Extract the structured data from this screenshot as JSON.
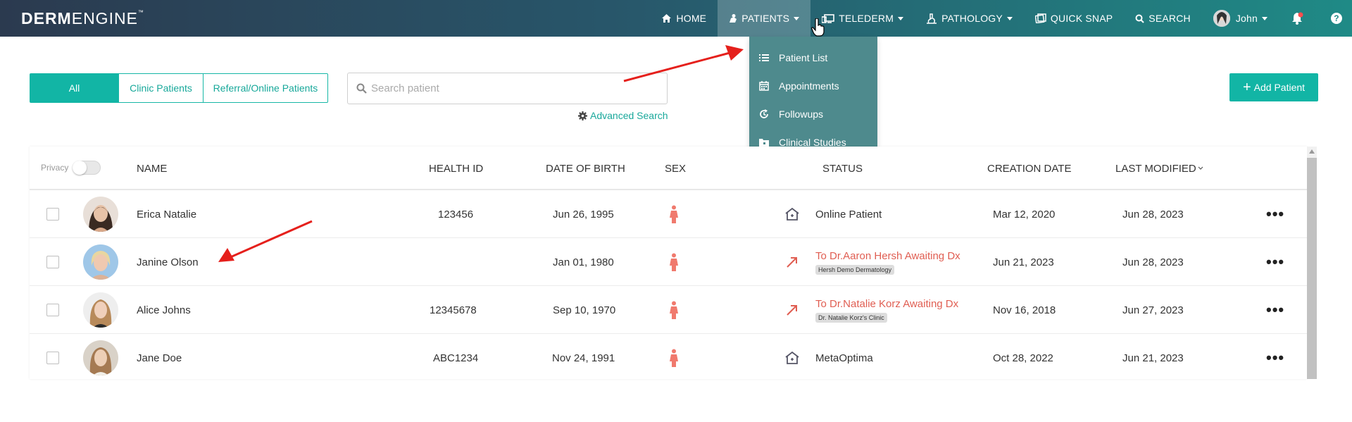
{
  "brand": {
    "bold": "DERM",
    "light": "ENGINE",
    "tm": "™"
  },
  "nav": {
    "home": "HOME",
    "patients": "PATIENTS",
    "telederm": "TELEDERM",
    "pathology": "PATHOLOGY",
    "quick_snap": "QUICK SNAP",
    "search": "SEARCH",
    "user": "John",
    "help": "?"
  },
  "patients_menu": {
    "items": [
      {
        "label": "Patient List",
        "icon": "list-icon"
      },
      {
        "label": "Appointments",
        "icon": "calendar-icon"
      },
      {
        "label": "Followups",
        "icon": "followup-icon"
      },
      {
        "label": "Clinical Studies",
        "icon": "folder-icon"
      }
    ]
  },
  "filters": {
    "all": "All",
    "clinic": "Clinic Patients",
    "referral": "Referral/Online Patients"
  },
  "search": {
    "placeholder": "Search patient",
    "advanced": "Advanced Search"
  },
  "add_patient": "Add Patient",
  "table": {
    "privacy": "Privacy",
    "headers": {
      "name": "NAME",
      "health_id": "HEALTH ID",
      "dob": "DATE OF BIRTH",
      "sex": "SEX",
      "status": "STATUS",
      "creation_date": "CREATION DATE",
      "last_modified": "LAST MODIFIED"
    },
    "rows": [
      {
        "name": "Erica Natalie",
        "health_id": "123456",
        "dob": "Jun 26, 1995",
        "status": "Online Patient",
        "status_type": "home",
        "clinic": "",
        "created": "Mar 12, 2020",
        "modified": "Jun 28, 2023"
      },
      {
        "name": "Janine Olson",
        "health_id": "",
        "dob": "Jan 01, 1980",
        "status": "To Dr.Aaron Hersh Awaiting Dx",
        "status_type": "referral",
        "clinic": "Hersh Demo Dermatology",
        "created": "Jun 21, 2023",
        "modified": "Jun 28, 2023"
      },
      {
        "name": "Alice Johns",
        "health_id": "12345678",
        "dob": "Sep 10, 1970",
        "status": "To Dr.Natalie Korz Awaiting Dx",
        "status_type": "referral",
        "clinic": "Dr. Natalie Korz's Clinic",
        "created": "Nov 16, 2018",
        "modified": "Jun 27, 2023"
      },
      {
        "name": "Jane Doe",
        "health_id": "ABC1234",
        "dob": "Nov 24, 1991",
        "status": "MetaOptima",
        "status_type": "home",
        "clinic": "",
        "created": "Oct 28, 2022",
        "modified": "Jun 21, 2023"
      }
    ],
    "more": "•••"
  },
  "colors": {
    "accent": "#12b5a5",
    "referral": "#e05e52",
    "female_icon": "#f07a6e"
  }
}
